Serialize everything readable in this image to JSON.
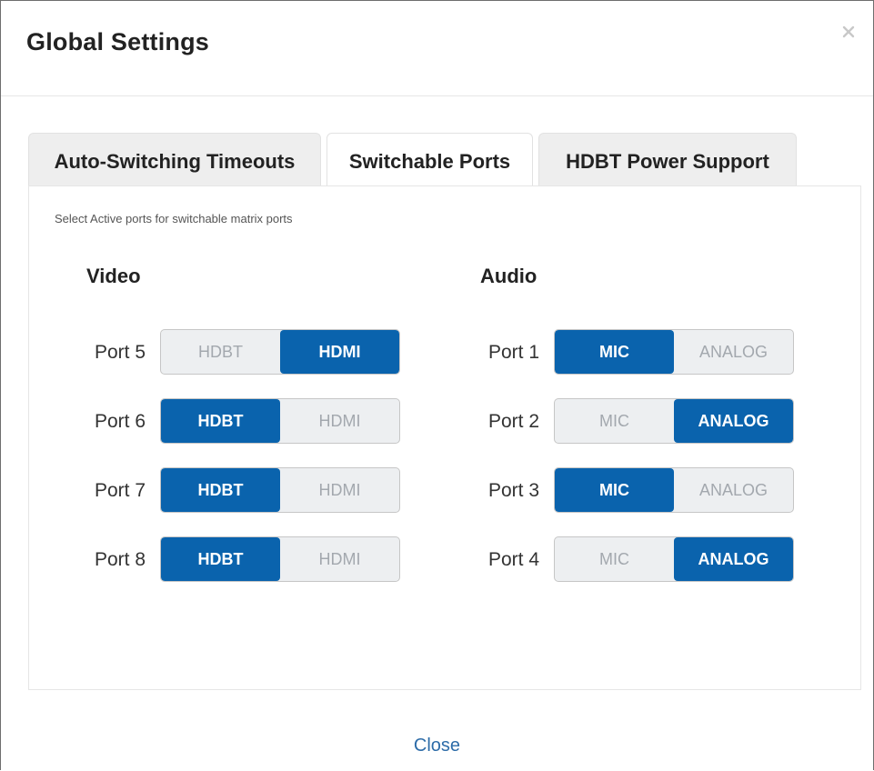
{
  "dialog": {
    "title": "Global Settings",
    "close_label": "Close"
  },
  "tabs": [
    {
      "label": "Auto-Switching Timeouts",
      "active": false
    },
    {
      "label": "Switchable Ports",
      "active": true
    },
    {
      "label": "HDBT Power Support",
      "active": false
    }
  ],
  "panel": {
    "instruction": "Select Active ports for switchable matrix ports",
    "video": {
      "title": "Video",
      "ports": [
        {
          "label": "Port 5",
          "options": [
            "HDBT",
            "HDMI"
          ],
          "selected": "HDMI"
        },
        {
          "label": "Port 6",
          "options": [
            "HDBT",
            "HDMI"
          ],
          "selected": "HDBT"
        },
        {
          "label": "Port 7",
          "options": [
            "HDBT",
            "HDMI"
          ],
          "selected": "HDBT"
        },
        {
          "label": "Port 8",
          "options": [
            "HDBT",
            "HDMI"
          ],
          "selected": "HDBT"
        }
      ]
    },
    "audio": {
      "title": "Audio",
      "ports": [
        {
          "label": "Port 1",
          "options": [
            "MIC",
            "ANALOG"
          ],
          "selected": "MIC"
        },
        {
          "label": "Port 2",
          "options": [
            "MIC",
            "ANALOG"
          ],
          "selected": "ANALOG"
        },
        {
          "label": "Port 3",
          "options": [
            "MIC",
            "ANALOG"
          ],
          "selected": "MIC"
        },
        {
          "label": "Port 4",
          "options": [
            "MIC",
            "ANALOG"
          ],
          "selected": "ANALOG"
        }
      ]
    }
  },
  "colors": {
    "accent": "#0a63ad",
    "inactive_option_text": "#a3a8ae",
    "link": "#2d6ca8"
  },
  "icons": {
    "close": "close-icon"
  }
}
